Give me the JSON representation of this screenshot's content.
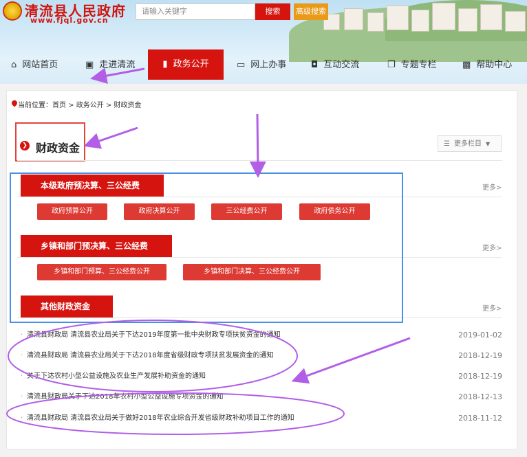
{
  "header": {
    "site_title": "清流县人民政府",
    "site_url": "www.fjql.gov.cn",
    "search_placeholder": "请输入关键字",
    "search_label": "搜索",
    "advanced_search_label": "高级搜索"
  },
  "nav": [
    {
      "label": "网站首页",
      "icon": "home-icon"
    },
    {
      "label": "走进清流",
      "icon": "picture-icon"
    },
    {
      "label": "政务公开",
      "icon": "bookmark-icon",
      "active": true
    },
    {
      "label": "网上办事",
      "icon": "monitor-icon"
    },
    {
      "label": "互动交流",
      "icon": "chat-icon"
    },
    {
      "label": "专题专栏",
      "icon": "window-icon"
    },
    {
      "label": "帮助中心",
      "icon": "help-icon"
    }
  ],
  "breadcrumb": "当前位置：首页 > 政务公开 > 财政资金",
  "section": {
    "title": "财政资金",
    "more_columns": "更多栏目"
  },
  "categories": [
    {
      "title": "本级政府预决算、三公经费",
      "more": "更多>",
      "tags": [
        "政府预算公开",
        "政府决算公开",
        "三公经费公开",
        "政府债务公开"
      ]
    },
    {
      "title": "乡镇和部门预决算、三公经费",
      "more": "更多>",
      "tags": [
        "乡镇和部门预算、三公经费公开",
        "乡镇和部门决算、三公经费公开"
      ]
    },
    {
      "title": "其他财政资金",
      "more": "更多>"
    }
  ],
  "news": [
    {
      "title": "清流县财政局 清流县农业局关于下达2019年度第一批中央财政专项扶贫资金的通知",
      "date": "2019-01-02"
    },
    {
      "title": "清流县财政局 清流县农业局关于下达2018年度省级财政专项扶贫发展资金的通知",
      "date": "2018-12-19"
    },
    {
      "title": "关于下达农村小型公益设施及农业生产发展补助资金的通知",
      "date": "2018-12-19"
    },
    {
      "title": "清流县财政局关于下达2018年农村小型公益设施专项资金的通知",
      "date": "2018-12-13"
    },
    {
      "title": "清流县财政局 清流县农业局关于做好2018年农业综合开发省级财政补助项目工作的通知",
      "date": "2018-11-12"
    }
  ],
  "colors": {
    "brand_red": "#d6140f",
    "annotation_purple": "#b25ee6",
    "annotation_blue": "#4b8fe3"
  }
}
